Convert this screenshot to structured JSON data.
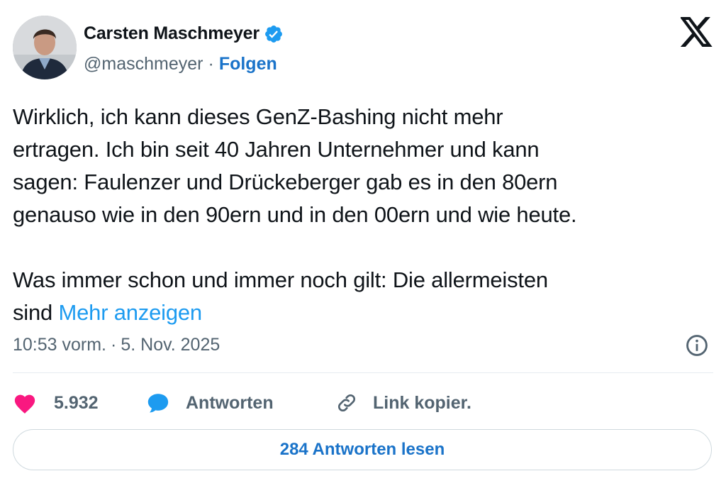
{
  "author": {
    "name": "Carsten Maschmeyer",
    "handle": "@maschmeyer",
    "separator": "·",
    "follow_label": "Folgen"
  },
  "tweet": {
    "text": "Wirklich, ich kann dieses GenZ-Bashing nicht mehr\nertragen. Ich bin seit 40 Jahren Unternehmer und kann\nsagen: Faulenzer und Drückeberger gab es in den 80ern\ngenauso wie in den 90ern und in den 00ern und wie heute.\n\nWas immer schon und immer noch gilt: Die allermeisten\nsind ",
    "more_label": "Mehr anzeigen",
    "time": "10:53 vorm.",
    "meta_separator": "·",
    "date": "5. Nov. 2025"
  },
  "actions": {
    "likes": "5.932",
    "reply_label": "Antworten",
    "link_label": "Link kopier."
  },
  "read_replies_label": "284 Antworten lesen",
  "colors": {
    "accent": "#1d9bf0",
    "link_blue": "#1a73c9",
    "heart": "#f91880",
    "muted": "#536471"
  },
  "icons": [
    "verified-badge-icon",
    "x-logo-icon",
    "info-icon",
    "heart-icon",
    "reply-bubble-icon",
    "link-icon"
  ]
}
